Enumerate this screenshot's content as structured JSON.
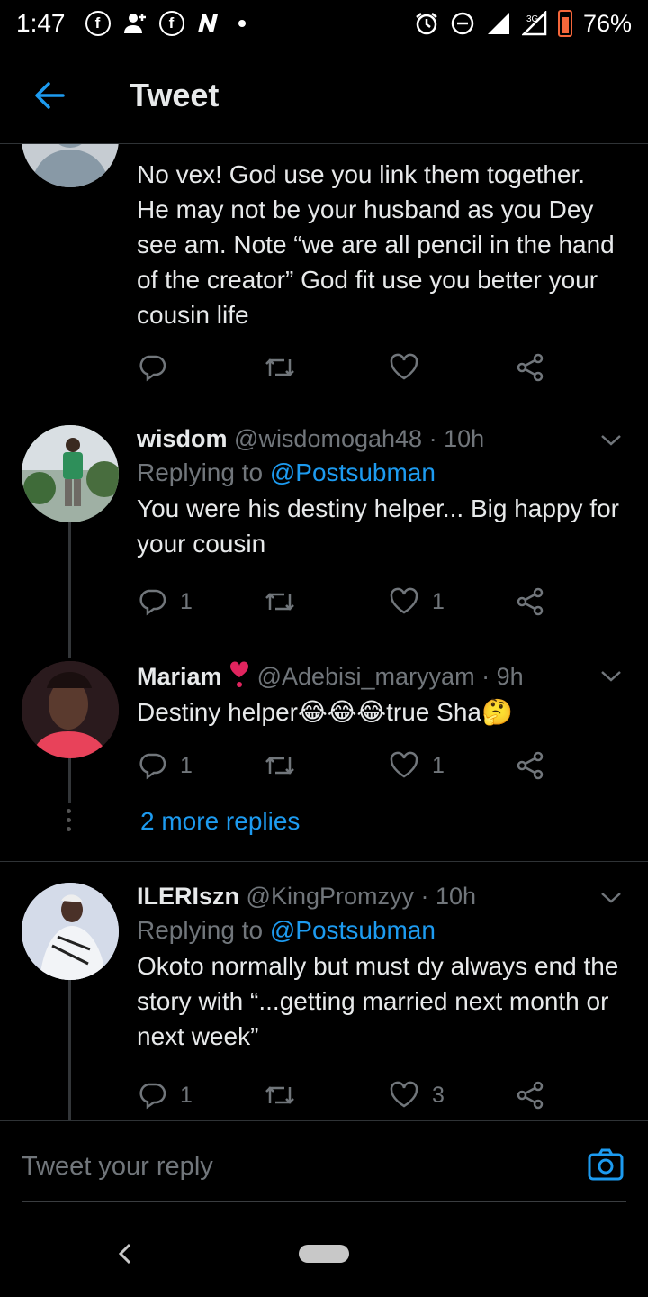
{
  "status_bar": {
    "time": "1:47",
    "battery": "76%",
    "network": "3G",
    "notification_icons": [
      "facebook-icon",
      "add-user-icon",
      "facebook-icon",
      "n-icon",
      "dot-icon"
    ],
    "right_icons": [
      "alarm-icon",
      "dnd-icon",
      "signal-icon",
      "signal-3g-icon",
      "battery-icon"
    ]
  },
  "header": {
    "title": "Tweet"
  },
  "first_tweet": {
    "text": "No vex! God use you link them together. He may not be your husband as you Dey see am. Note “we are all pencil in the hand of the creator” God fit use you better your cousin life"
  },
  "tweets": [
    {
      "name": "wisdom",
      "handle": "@wisdomogah48",
      "time": "· 10h",
      "replying_label": "Replying to",
      "replying_to": "@Postsubman",
      "text": "You were his destiny helper... Big happy for your cousin",
      "replies": "1",
      "retweets": "",
      "likes": "1"
    },
    {
      "name": "Mariam",
      "handle": "@Adebisi_maryyam",
      "time": "· 9h",
      "text": "Destiny helper😂😂😂true Sha🤔",
      "replies": "1",
      "retweets": "",
      "likes": "1"
    },
    {
      "name": "ILERIszn",
      "handle": "@KingPromzyy",
      "time": "· 10h",
      "replying_label": "Replying to",
      "replying_to": "@Postsubman",
      "text": "Okoto normally but must dy always end the story with “...getting married next month or next week”",
      "replies": "1",
      "retweets": "",
      "likes": "3"
    }
  ],
  "more_replies": "2 more replies",
  "composer": {
    "placeholder": "Tweet your reply"
  },
  "colors": {
    "accent": "#1d9bf0",
    "background": "#000000",
    "muted": "#71767b",
    "heart_emoji": "#e0245e"
  }
}
